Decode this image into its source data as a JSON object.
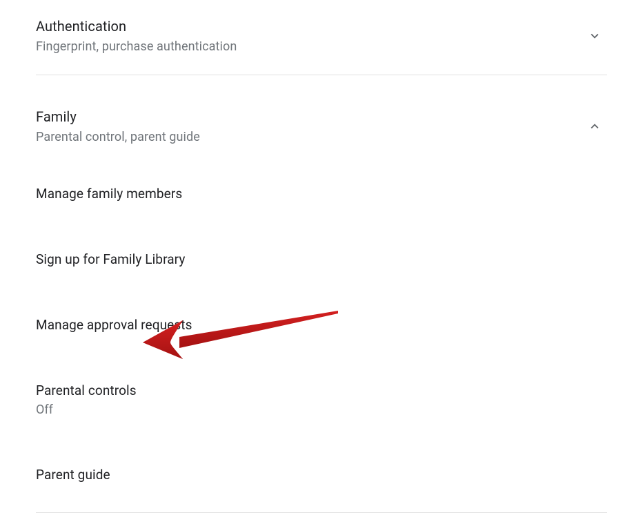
{
  "sections": {
    "authentication": {
      "title": "Authentication",
      "subtitle": "Fingerprint, purchase authentication"
    },
    "family": {
      "title": "Family",
      "subtitle": "Parental control, parent guide",
      "items": [
        {
          "title": "Manage family members"
        },
        {
          "title": "Sign up for Family Library"
        },
        {
          "title": "Manage approval requests"
        },
        {
          "title": "Parental controls",
          "subtitle": "Off"
        },
        {
          "title": "Parent guide"
        }
      ]
    }
  }
}
